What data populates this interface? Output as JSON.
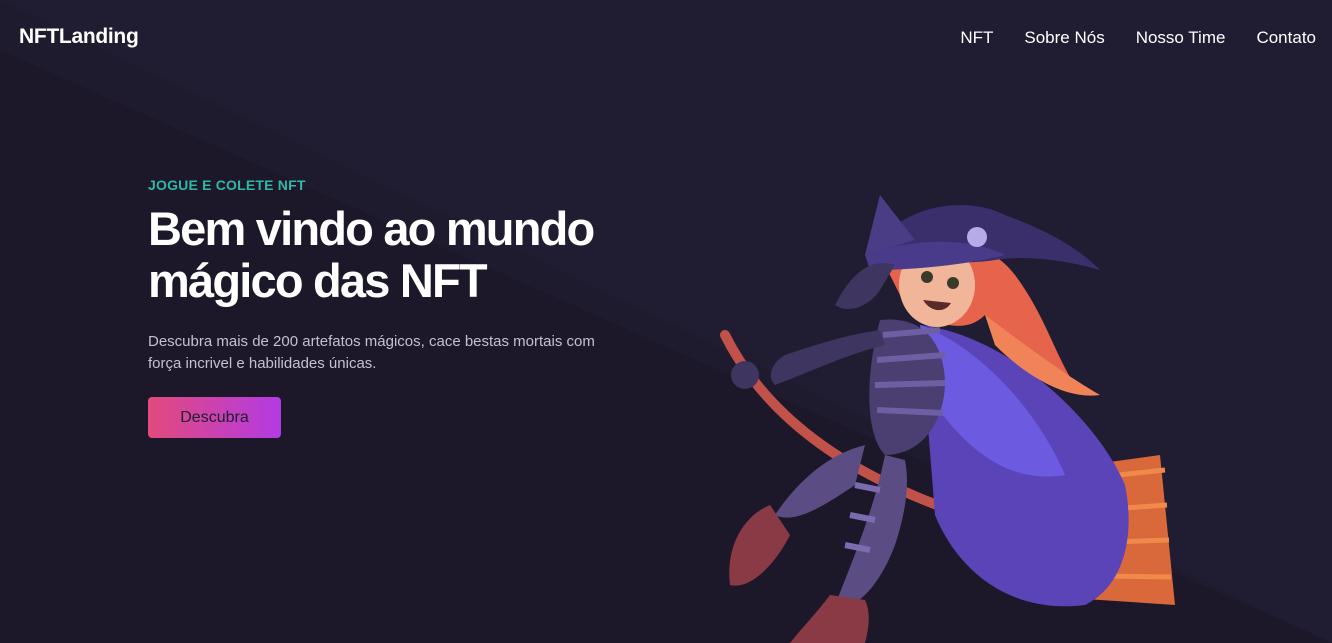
{
  "brand": "NFTLanding",
  "nav": {
    "items": [
      {
        "label": "NFT"
      },
      {
        "label": "Sobre Nós"
      },
      {
        "label": "Nosso Time"
      },
      {
        "label": "Contato"
      }
    ]
  },
  "hero": {
    "eyebrow": "JOGUE E COLETE NFT",
    "title_line1": "Bem vindo ao mundo",
    "title_line2": "mágico das NFT",
    "description_line1": "Descubra mais de 200 artefatos mágicos, cace bestas mortais com",
    "description_line2": "força incrivel e habilidades únicas.",
    "cta_label": "Descubra"
  },
  "illustration": {
    "icon": "witch-on-broom-illustration"
  },
  "colors": {
    "background": "#1f1b2e",
    "accent_teal": "#2fb8a5",
    "button_gradient_start": "#e24a7a",
    "button_gradient_end": "#b33ae5"
  }
}
